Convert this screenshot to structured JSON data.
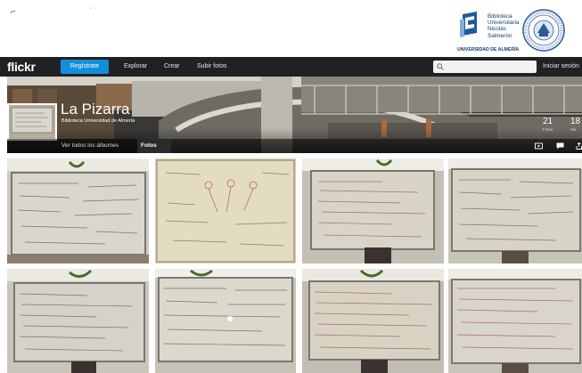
{
  "header": {
    "top_marks": "⌐ ˙",
    "library_logo": {
      "lines": [
        "Biblioteca",
        "Universitaria",
        "Nicolás",
        "Salmerón"
      ],
      "university": "UNIVERSIDAD DE ALMERÍA"
    }
  },
  "nav": {
    "brand": "flickr",
    "register": "Regístrate",
    "links": [
      "Explorar",
      "Crear",
      "Subir fotos"
    ],
    "search_placeholder": "",
    "signin": "Iniciar sesión"
  },
  "album": {
    "title": "La Pizarra",
    "owner": "Biblioteca Universidad de Almería",
    "stats": [
      {
        "value": "21",
        "label": "Fotos"
      },
      {
        "value": "18",
        "label": "Vis"
      }
    ],
    "tabs": [
      "Ver todos los álbumes",
      "Fotos"
    ],
    "active_tab": "Fotos"
  },
  "photos": [
    {
      "alt": "whiteboard-photo-1",
      "tint": "#d8d6ce"
    },
    {
      "alt": "whiteboard-photo-2",
      "tint": "#e4dcc2"
    },
    {
      "alt": "whiteboard-photo-3",
      "tint": "#d9d4c8"
    },
    {
      "alt": "whiteboard-photo-4",
      "tint": "#d7d4c6"
    },
    {
      "alt": "whiteboard-photo-5",
      "tint": "#d5d3c9"
    },
    {
      "alt": "whiteboard-photo-6",
      "tint": "#dcd8cc"
    },
    {
      "alt": "whiteboard-photo-7",
      "tint": "#d8d2c4"
    },
    {
      "alt": "whiteboard-photo-8",
      "tint": "#d9d5cd"
    }
  ],
  "colors": {
    "nav_bg": "#212124",
    "register_blue": "#128fdc",
    "logo_blue": "#1a3c6e"
  }
}
